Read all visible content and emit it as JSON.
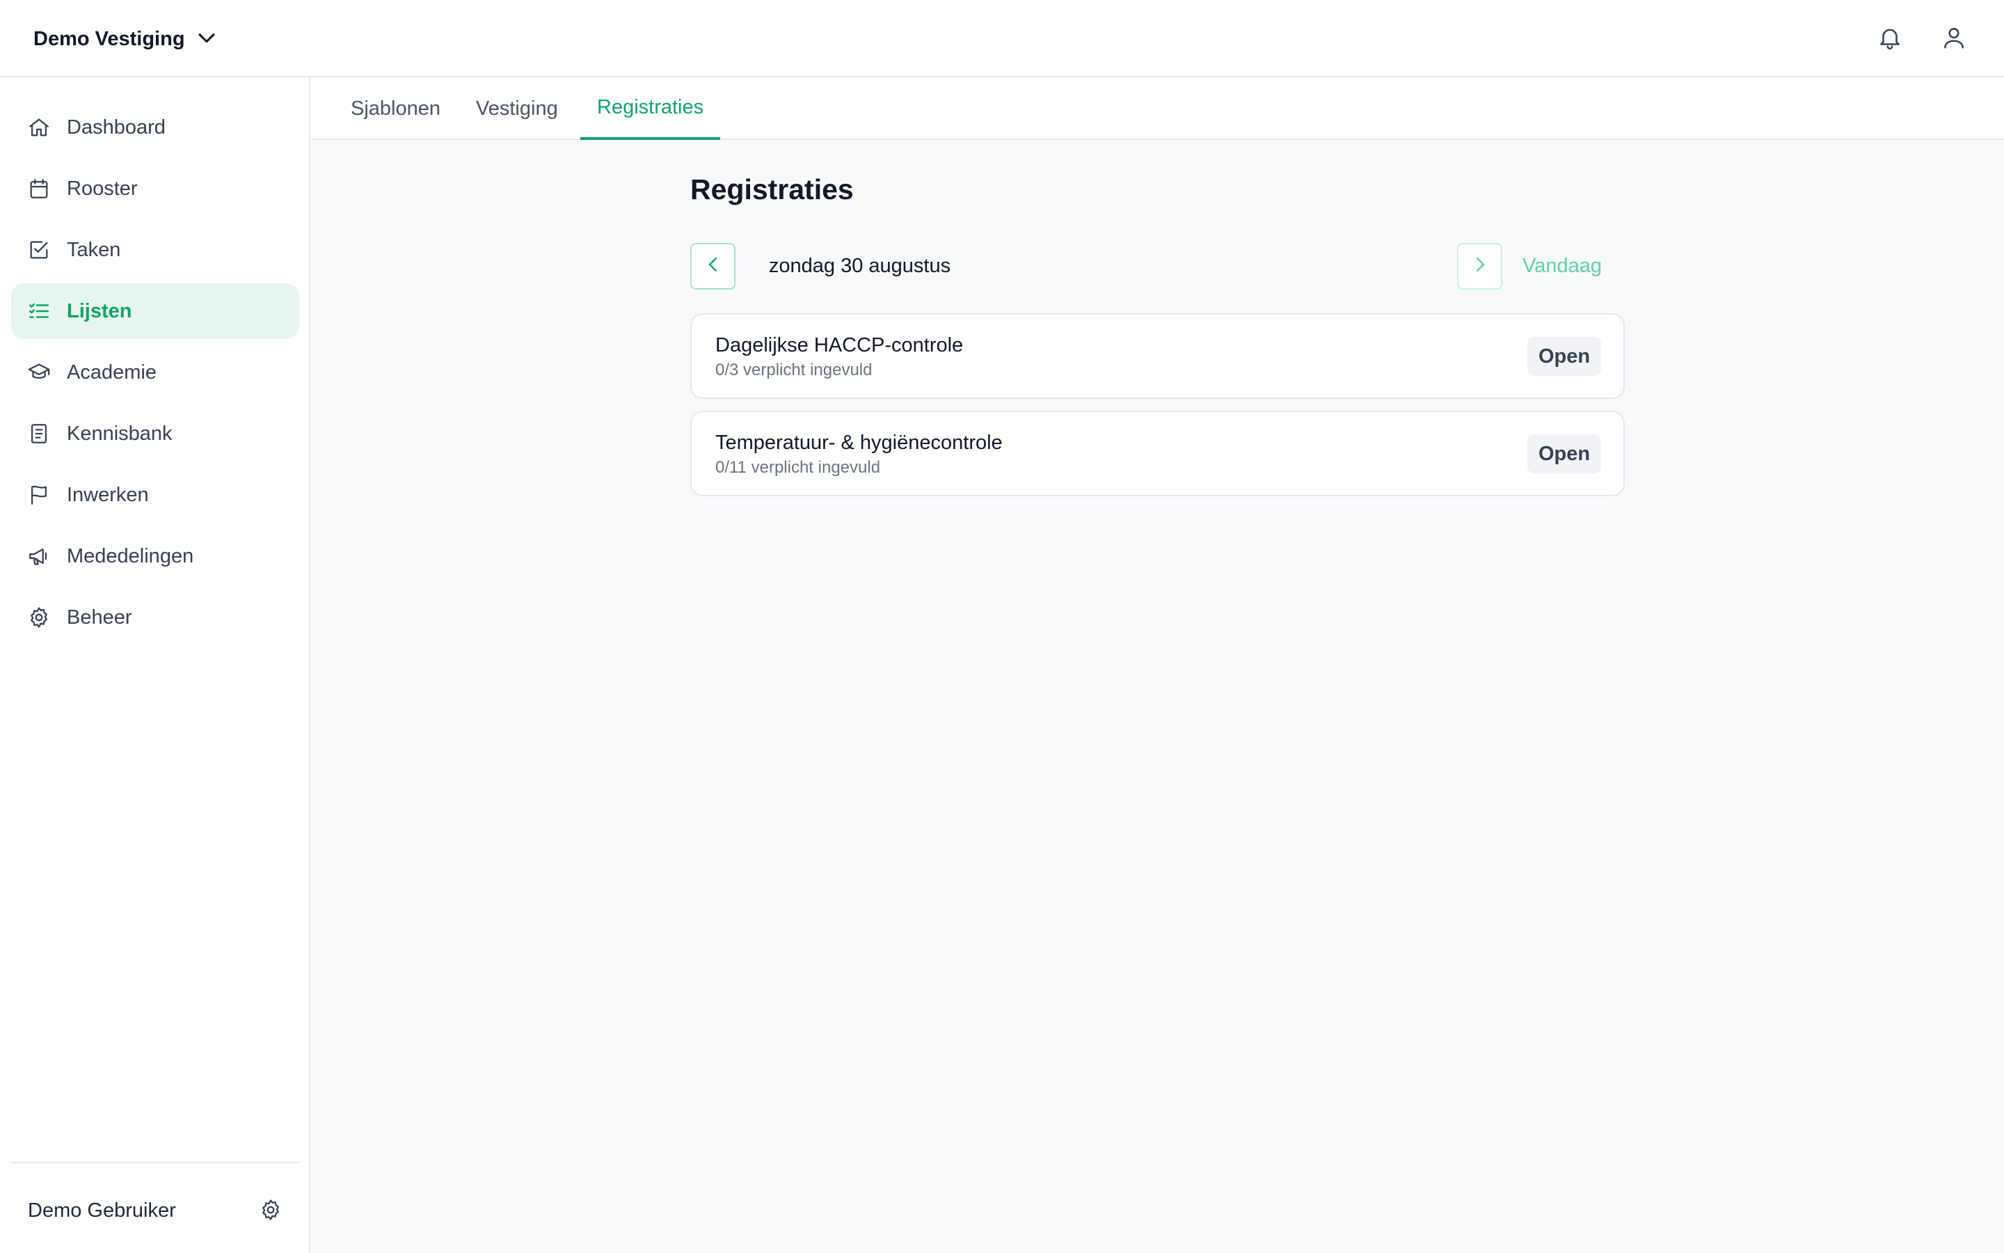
{
  "header": {
    "location_name": "Demo Vestiging",
    "icons": [
      "chevron-down-icon",
      "bell-icon",
      "user-icon"
    ]
  },
  "sidebar": {
    "items": [
      {
        "label": "Dashboard",
        "icon": "home-icon",
        "active": false
      },
      {
        "label": "Rooster",
        "icon": "calendar-icon",
        "active": false
      },
      {
        "label": "Taken",
        "icon": "check-square-icon",
        "active": false
      },
      {
        "label": "Lijsten",
        "icon": "list-checks-icon",
        "active": true
      },
      {
        "label": "Academie",
        "icon": "graduation-cap-icon",
        "active": false
      },
      {
        "label": "Kennisbank",
        "icon": "book-icon",
        "active": false
      },
      {
        "label": "Inwerken",
        "icon": "flag-icon",
        "active": false
      },
      {
        "label": "Mededelingen",
        "icon": "megaphone-icon",
        "active": false
      },
      {
        "label": "Beheer",
        "icon": "gear-icon",
        "active": false
      }
    ],
    "user_name": "Demo Gebruiker"
  },
  "tabs": [
    {
      "label": "Sjablonen",
      "active": false
    },
    {
      "label": "Vestiging",
      "active": false
    },
    {
      "label": "Registraties",
      "active": true
    }
  ],
  "page": {
    "title": "Registraties",
    "date_label": "zondag 30 augustus",
    "today_label": "Vandaag"
  },
  "registrations": [
    {
      "title": "Dagelijkse HACCP-controle",
      "progress": "0/3 verplicht ingevuld",
      "action": "Open"
    },
    {
      "title": "Temperatuur- & hygiënecontrole",
      "progress": "0/11 verplicht ingevuld",
      "action": "Open"
    }
  ],
  "colors": {
    "accent": "#10a36b",
    "accent_light_bg": "#e6f6ef",
    "today_link": "#5fd1a1",
    "main_bg": "#f8f9fb",
    "border": "#e5e7eb"
  }
}
